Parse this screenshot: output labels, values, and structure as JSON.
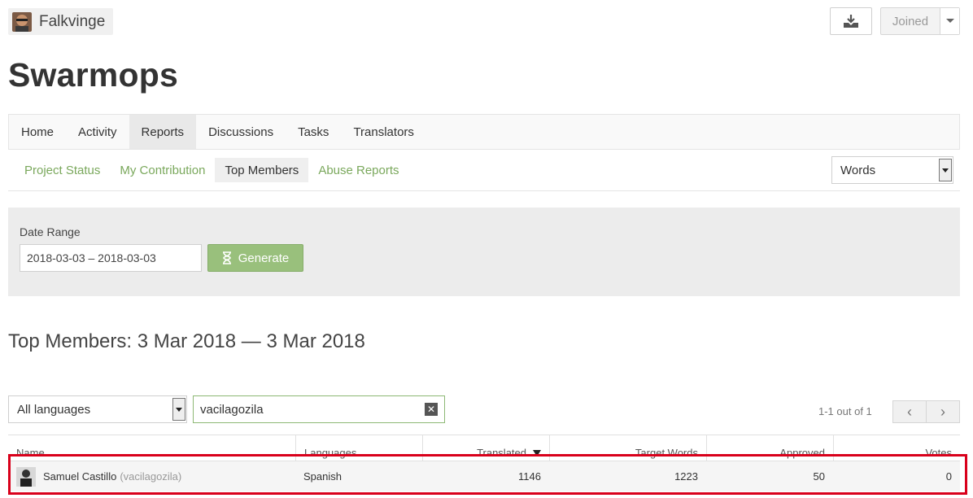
{
  "owner": {
    "name": "Falkvinge"
  },
  "header": {
    "joined_label": "Joined",
    "download_icon": "download-icon"
  },
  "project": {
    "title": "Swarmops"
  },
  "main_nav": [
    {
      "label": "Home",
      "active": false
    },
    {
      "label": "Activity",
      "active": false
    },
    {
      "label": "Reports",
      "active": true
    },
    {
      "label": "Discussions",
      "active": false
    },
    {
      "label": "Tasks",
      "active": false
    },
    {
      "label": "Translators",
      "active": false
    }
  ],
  "sub_nav": [
    {
      "label": "Project Status",
      "active": false
    },
    {
      "label": "My Contribution",
      "active": false
    },
    {
      "label": "Top Members",
      "active": true
    },
    {
      "label": "Abuse Reports",
      "active": false
    }
  ],
  "metric_select": {
    "value": "Words"
  },
  "date_range": {
    "label": "Date Range",
    "value": "2018-03-03 – 2018-03-03",
    "generate_label": "Generate"
  },
  "report": {
    "heading": "Top Members: 3 Mar 2018 — 3 Mar 2018"
  },
  "filters": {
    "language": "All languages",
    "search_value": "vacilagozila"
  },
  "pagination": {
    "text": "1-1 out of 1"
  },
  "table": {
    "columns": [
      "Name",
      "Languages",
      "Translated",
      "Target Words",
      "Approved",
      "Votes"
    ],
    "rows": [
      {
        "name": "Samuel Castillo",
        "username": "(vacilagozila)",
        "languages": "Spanish",
        "translated": "1146",
        "target_words": "1223",
        "approved": "50",
        "votes": "0"
      }
    ]
  },
  "colors": {
    "accent_green": "#7aa85c",
    "button_green": "#99c07c",
    "highlight_red": "#d9001b"
  }
}
